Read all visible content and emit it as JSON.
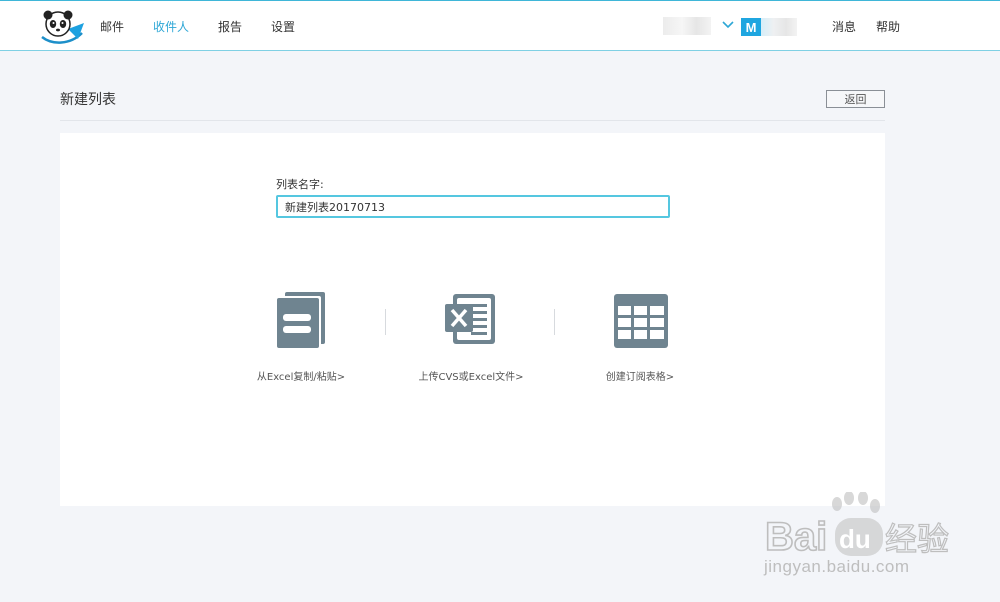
{
  "header": {
    "nav": [
      {
        "label": "邮件",
        "active": false
      },
      {
        "label": "收件人",
        "active": true
      },
      {
        "label": "报告",
        "active": false
      },
      {
        "label": "设置",
        "active": false
      }
    ],
    "avatar_letter": "M",
    "right_links": [
      {
        "label": "消息"
      },
      {
        "label": "帮助"
      }
    ]
  },
  "page": {
    "title": "新建列表",
    "back_label": "返回"
  },
  "form": {
    "name_label": "列表名字:",
    "name_value": "新建列表20170713"
  },
  "options": [
    {
      "label": "从Excel复制/粘贴>",
      "icon": "copy-paste-icon"
    },
    {
      "label": "上传CVS或Excel文件>",
      "icon": "excel-file-icon"
    },
    {
      "label": "创建订阅表格>",
      "icon": "table-grid-icon"
    }
  ],
  "watermark": {
    "brand": "Bai",
    "brand_tail": "du",
    "suffix": "经验",
    "domain": "jingyan.baidu.com"
  },
  "colors": {
    "accent": "#2ea7d6",
    "icon_gray": "#6f8490",
    "input_border": "#55c7e0",
    "avatar_bg": "#1fa6e0"
  }
}
